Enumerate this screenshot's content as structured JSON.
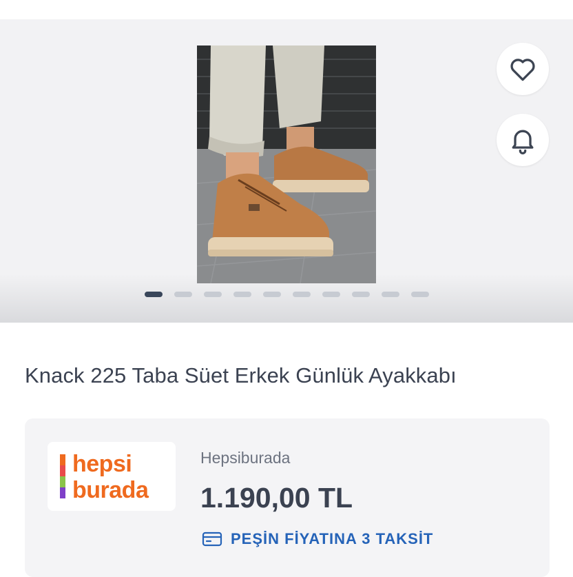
{
  "gallery": {
    "image_alt": "Knack 225 Taba Süet Erkek Günlük Ayakkabı",
    "slide_count": 10,
    "active_slide": 1,
    "icons": {
      "favorite": "heart-icon",
      "notify": "bell-icon"
    },
    "colors": {
      "dot_active": "#39465a",
      "dot_inactive": "#c7cbd2"
    }
  },
  "product": {
    "title": "Knack 225 Taba Süet Erkek Günlük Ayakkabı"
  },
  "offer": {
    "logo_line1": "hepsi",
    "logo_line2": "burada",
    "seller_name": "Hepsiburada",
    "price": "1.190,00 TL",
    "installment_label": "PEŞİN FİYATINA 3 TAKSİT",
    "installment_icon": "credit-card-icon",
    "colors": {
      "logo_text": "#ef6a1f",
      "installment": "#2563b8",
      "price": "#3b4251"
    }
  }
}
